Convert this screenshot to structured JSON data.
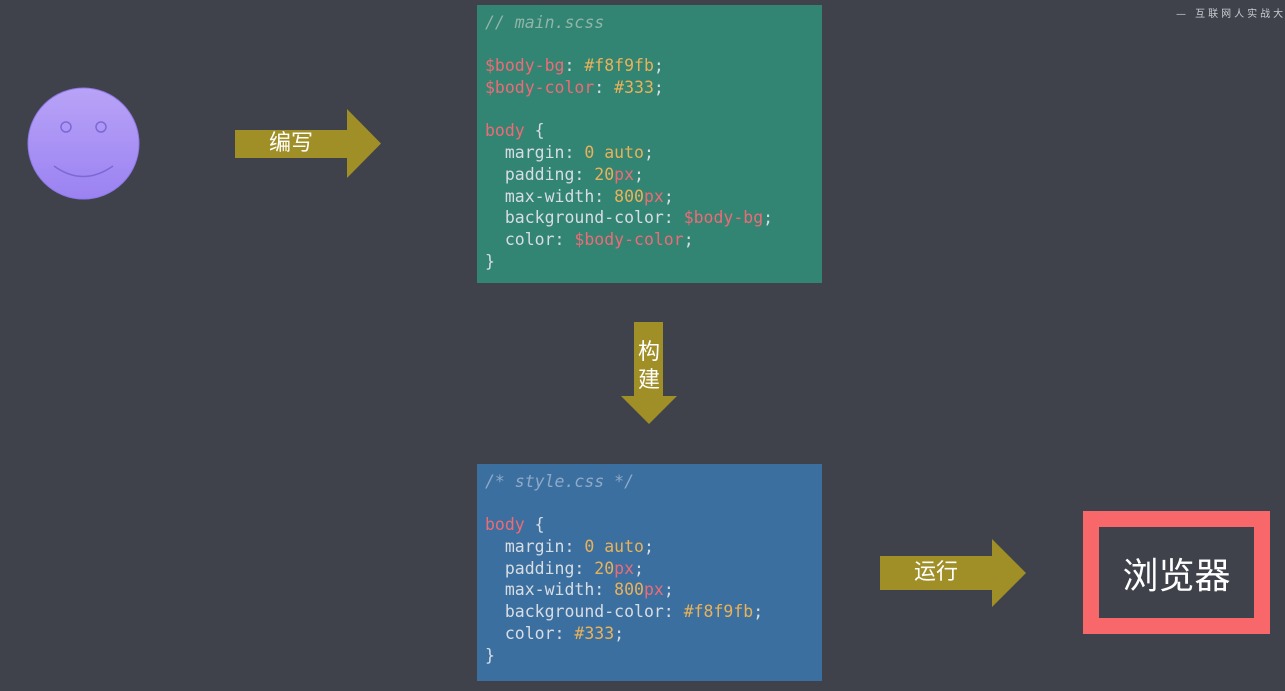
{
  "watermark": "— 互联网人实战大",
  "arrows": {
    "write": "编写",
    "build_1": "构",
    "build_2": "建",
    "run": "运行"
  },
  "browser_label": "浏览器",
  "scss_code": [
    [
      {
        "t": "// main.scss",
        "c": "c-comment"
      }
    ],
    [],
    [
      {
        "t": "$body-bg",
        "c": "c-var"
      },
      {
        "t": ": "
      },
      {
        "t": "#f8f9fb",
        "c": "c-val"
      },
      {
        "t": ";"
      }
    ],
    [
      {
        "t": "$body-color",
        "c": "c-var"
      },
      {
        "t": ": "
      },
      {
        "t": "#333",
        "c": "c-val"
      },
      {
        "t": ";"
      }
    ],
    [],
    [
      {
        "t": "body",
        "c": "c-sel"
      },
      {
        "t": " {"
      }
    ],
    [
      {
        "t": "  margin: "
      },
      {
        "t": "0",
        "c": "c-num"
      },
      {
        "t": " "
      },
      {
        "t": "auto",
        "c": "c-val"
      },
      {
        "t": ";"
      }
    ],
    [
      {
        "t": "  padding: "
      },
      {
        "t": "20",
        "c": "c-num"
      },
      {
        "t": "px",
        "c": "c-unit"
      },
      {
        "t": ";"
      }
    ],
    [
      {
        "t": "  max-width: "
      },
      {
        "t": "800",
        "c": "c-num"
      },
      {
        "t": "px",
        "c": "c-unit"
      },
      {
        "t": ";"
      }
    ],
    [
      {
        "t": "  background-color: "
      },
      {
        "t": "$body-bg",
        "c": "c-var"
      },
      {
        "t": ";"
      }
    ],
    [
      {
        "t": "  color: "
      },
      {
        "t": "$body-color",
        "c": "c-var"
      },
      {
        "t": ";"
      }
    ],
    [
      {
        "t": "}"
      }
    ]
  ],
  "css_code": [
    [
      {
        "t": "/* style.css */",
        "c": "c-comment"
      }
    ],
    [],
    [
      {
        "t": "body",
        "c": "c-sel"
      },
      {
        "t": " {"
      }
    ],
    [
      {
        "t": "  margin: "
      },
      {
        "t": "0",
        "c": "c-num"
      },
      {
        "t": " "
      },
      {
        "t": "auto",
        "c": "c-val"
      },
      {
        "t": ";"
      }
    ],
    [
      {
        "t": "  padding: "
      },
      {
        "t": "20",
        "c": "c-num"
      },
      {
        "t": "px",
        "c": "c-unit"
      },
      {
        "t": ";"
      }
    ],
    [
      {
        "t": "  max-width: "
      },
      {
        "t": "800",
        "c": "c-num"
      },
      {
        "t": "px",
        "c": "c-unit"
      },
      {
        "t": ";"
      }
    ],
    [
      {
        "t": "  background-color: "
      },
      {
        "t": "#f8f9fb",
        "c": "c-val"
      },
      {
        "t": ";"
      }
    ],
    [
      {
        "t": "  color: "
      },
      {
        "t": "#333",
        "c": "c-val"
      },
      {
        "t": ";"
      }
    ],
    [
      {
        "t": "}"
      }
    ]
  ],
  "colors": {
    "background": "#3f424b",
    "arrow": "#a08e27",
    "scss_panel": "#328473",
    "css_panel": "#3b6f9f",
    "browser_border": "#f86769",
    "smiley": "#a78bfa"
  }
}
